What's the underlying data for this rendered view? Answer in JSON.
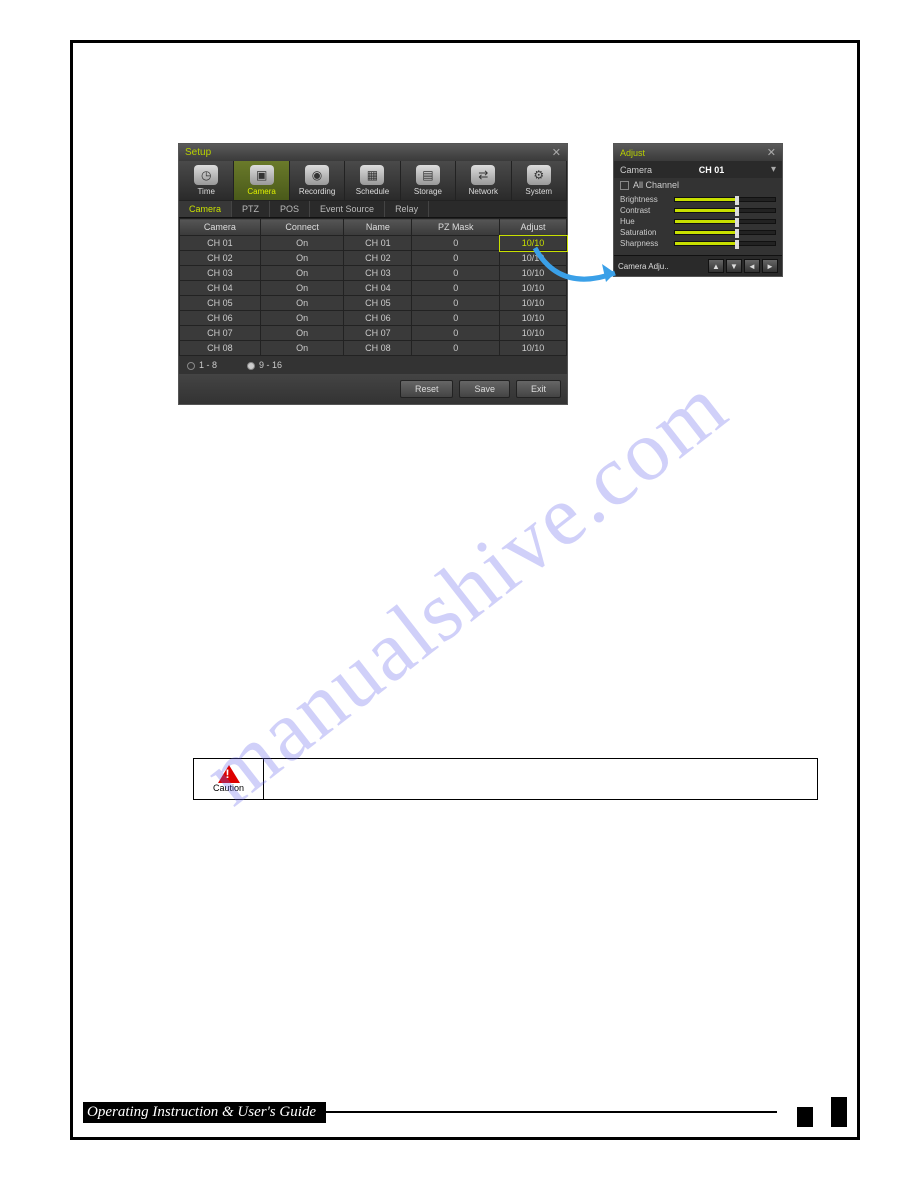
{
  "watermark": "manualshive.com",
  "setup": {
    "title": "Setup",
    "toolbar": [
      {
        "label": "Time",
        "icon": "clock-icon"
      },
      {
        "label": "Camera",
        "icon": "camera-icon",
        "active": true
      },
      {
        "label": "Recording",
        "icon": "recording-icon"
      },
      {
        "label": "Schedule",
        "icon": "schedule-icon"
      },
      {
        "label": "Storage",
        "icon": "storage-icon"
      },
      {
        "label": "Network",
        "icon": "network-icon"
      },
      {
        "label": "System",
        "icon": "system-icon"
      }
    ],
    "subtabs": [
      {
        "label": "Camera",
        "active": true
      },
      {
        "label": "PTZ"
      },
      {
        "label": "POS"
      },
      {
        "label": "Event Source"
      },
      {
        "label": "Relay"
      }
    ],
    "columns": [
      "Camera",
      "Connect",
      "Name",
      "PZ Mask",
      "Adjust"
    ],
    "rows": [
      {
        "camera": "CH 01",
        "connect": "On",
        "name": "CH 01",
        "pz": "0",
        "adjust": "10/10",
        "hl": true
      },
      {
        "camera": "CH 02",
        "connect": "On",
        "name": "CH 02",
        "pz": "0",
        "adjust": "10/10"
      },
      {
        "camera": "CH 03",
        "connect": "On",
        "name": "CH 03",
        "pz": "0",
        "adjust": "10/10"
      },
      {
        "camera": "CH 04",
        "connect": "On",
        "name": "CH 04",
        "pz": "0",
        "adjust": "10/10"
      },
      {
        "camera": "CH 05",
        "connect": "On",
        "name": "CH 05",
        "pz": "0",
        "adjust": "10/10"
      },
      {
        "camera": "CH 06",
        "connect": "On",
        "name": "CH 06",
        "pz": "0",
        "adjust": "10/10"
      },
      {
        "camera": "CH 07",
        "connect": "On",
        "name": "CH 07",
        "pz": "0",
        "adjust": "10/10"
      },
      {
        "camera": "CH 08",
        "connect": "On",
        "name": "CH 08",
        "pz": "0",
        "adjust": "10/10"
      }
    ],
    "radio1": "1 - 8",
    "radio2": "9 - 16",
    "buttons": {
      "reset": "Reset",
      "save": "Save",
      "exit": "Exit"
    }
  },
  "adjust": {
    "title": "Adjust",
    "camera_label": "Camera",
    "camera_value": "CH 01",
    "all_channel": "All Channel",
    "sliders": [
      "Brightness",
      "Contrast",
      "Hue",
      "Saturation",
      "Sharpness"
    ],
    "camera_adj": "Camera Adju.."
  },
  "caution": {
    "label": "Caution"
  },
  "footer": {
    "title": "Operating Instruction & User's Guide"
  }
}
